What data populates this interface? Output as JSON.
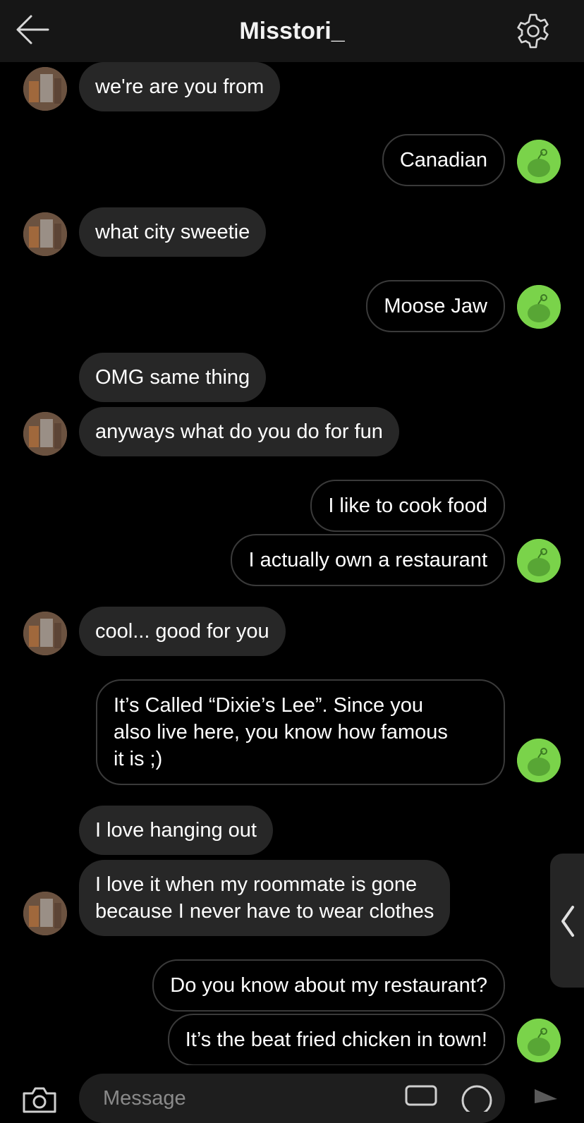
{
  "header": {
    "title": "Misstori_"
  },
  "messages": [
    {
      "sender": "them",
      "text": "we're are you from"
    },
    {
      "sender": "me",
      "text": "Canadian"
    },
    {
      "sender": "them",
      "text": "what city sweetie"
    },
    {
      "sender": "me",
      "text": "Moose Jaw"
    },
    {
      "sender": "them",
      "text": "OMG same thing"
    },
    {
      "sender": "them",
      "text": "anyways what do you do for fun"
    },
    {
      "sender": "me",
      "text": "I like to cook food"
    },
    {
      "sender": "me",
      "text": "I actually own a restaurant"
    },
    {
      "sender": "them",
      "text": "cool... good for you"
    },
    {
      "sender": "me",
      "lines": [
        "It’s Called “Dixie’s Lee”. Since you",
        "also live here, you know how famous",
        "it is ;)"
      ]
    },
    {
      "sender": "them",
      "text": "I love hanging out"
    },
    {
      "sender": "them",
      "lines": [
        "I love it when my roommate is gone",
        "because I never have to wear clothes"
      ]
    },
    {
      "sender": "me",
      "text": "Do you know about my restaurant?"
    },
    {
      "sender": "me",
      "text": "It’s the beat fried chicken in town!"
    }
  ],
  "composer": {
    "placeholder": "Message"
  },
  "colors": {
    "background": "#000000",
    "header": "#161616",
    "incoming_bubble": "#272727",
    "outgoing_border": "#3a3a3a",
    "my_avatar": "#7ad34a"
  },
  "icons": {
    "back": "arrow-left-icon",
    "settings": "gear-icon",
    "camera": "camera-icon",
    "gif": "gif-icon",
    "emoji": "emoji-icon",
    "send": "send-icon",
    "side_tab": "chevron-left-icon"
  }
}
